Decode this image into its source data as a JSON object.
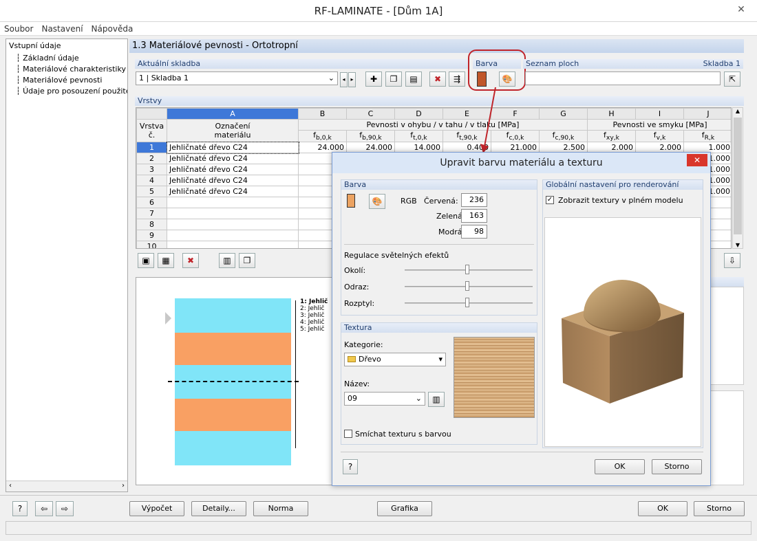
{
  "window": {
    "title": "RF-LAMINATE - [Dům 1A]"
  },
  "menu": [
    "Soubor",
    "Nastavení",
    "Nápověda"
  ],
  "tree": {
    "root": "Vstupní údaje",
    "items": [
      "Základní údaje",
      "Materiálové charakteristiky",
      "Materiálové pevnosti",
      "Údaje pro posouzení použitelnosti"
    ]
  },
  "section": {
    "title": "1.3 Materiálové pevnosti - Ortotropní"
  },
  "current_layup": {
    "label": "Aktuální skladba",
    "value": "1 | Skladba 1"
  },
  "color_group": {
    "label": "Barva",
    "color": "#c0562a"
  },
  "surface_list": {
    "label": "Seznam ploch",
    "right_label": "Skladba 1"
  },
  "layers": {
    "label": "Vrstvy",
    "col_letters": [
      "A",
      "B",
      "C",
      "D",
      "E",
      "F",
      "G",
      "H",
      "I",
      "J"
    ],
    "hdr_row_col": "Vrstva",
    "hdr_row_col2": "č.",
    "hdr_name": "Označení",
    "hdr_name2": "materiálu",
    "group_bending": "Pevnosti v ohybu / v tahu / v tlaku [MPa]",
    "group_shear": "Pevnosti ve smyku [MPa]",
    "subs": [
      "f",
      "b,0,k",
      "b,90,k",
      "t,0,k",
      "t,90,k",
      "c,0,k",
      "c,90,k",
      "xy,k",
      "v,k",
      "R,k"
    ],
    "rows": [
      {
        "n": "1",
        "name": "Jehličnaté dřevo C24",
        "vals": [
          "24.000",
          "24.000",
          "14.000",
          "0.400",
          "21.000",
          "2.500",
          "2.000",
          "2.000",
          "1.000"
        ]
      },
      {
        "n": "2",
        "name": "Jehličnaté dřevo C24",
        "vals": [
          "24.",
          "",
          "",
          "",
          "",
          "",
          "",
          "",
          "1.000"
        ]
      },
      {
        "n": "3",
        "name": "Jehličnaté dřevo C24",
        "vals": [
          "24.",
          "",
          "",
          "",
          "",
          "",
          "",
          "",
          "1.000"
        ]
      },
      {
        "n": "4",
        "name": "Jehličnaté dřevo C24",
        "vals": [
          "24.",
          "",
          "",
          "",
          "",
          "",
          "",
          "",
          "1.000"
        ]
      },
      {
        "n": "5",
        "name": "Jehličnaté dřevo C24",
        "vals": [
          "24.",
          "",
          "",
          "",
          "",
          "",
          "",
          "",
          "1.000"
        ]
      },
      {
        "n": "6",
        "name": "",
        "vals": [
          "",
          "",
          "",
          "",
          "",
          "",
          "",
          "",
          ""
        ]
      },
      {
        "n": "7",
        "name": "",
        "vals": [
          "",
          "",
          "",
          "",
          "",
          "",
          "",
          "",
          ""
        ]
      },
      {
        "n": "8",
        "name": "",
        "vals": [
          "",
          "",
          "",
          "",
          "",
          "",
          "",
          "",
          ""
        ]
      },
      {
        "n": "9",
        "name": "",
        "vals": [
          "",
          "",
          "",
          "",
          "",
          "",
          "",
          "",
          ""
        ]
      },
      {
        "n": "10",
        "name": "",
        "vals": [
          "",
          "",
          "",
          "",
          "",
          "",
          "",
          "",
          ""
        ]
      }
    ]
  },
  "legend": [
    "1: Jehlič",
    "2: Jehlič",
    "3: Jehlič",
    "4: Jehlič",
    "5: Jehlič"
  ],
  "dialog": {
    "title": "Upravit barvu materiálu a texturu",
    "color_group": "Barva",
    "rgb_label": "RGB",
    "red_label": "Červená:",
    "green_label": "Zelená:",
    "blue_label": "Modrá:",
    "red": "236",
    "green": "163",
    "blue": "98",
    "swatch_color": "#ec a362",
    "light_group": "Regulace světelných efektů",
    "ambient": "Okolí:",
    "reflection": "Odraz:",
    "diffuse": "Rozptyl:",
    "render_group": "Globální nastavení pro renderování",
    "show_textures": "Zobrazit textury v plném modelu",
    "texture_group": "Textura",
    "category_label": "Kategorie:",
    "category_value": "Dřevo",
    "name_label": "Název:",
    "name_value": "09",
    "mix_label": "Smíchat texturu s barvou",
    "ok": "OK",
    "cancel": "Storno"
  },
  "bottom": {
    "calc": "Výpočet",
    "details": "Detaily...",
    "norm": "Norma",
    "graphics": "Grafika",
    "ok": "OK",
    "cancel": "Storno"
  },
  "colors": {
    "cyan": "#80e5f8",
    "orange": "#f9a063",
    "accent_red": "#c0242a"
  }
}
